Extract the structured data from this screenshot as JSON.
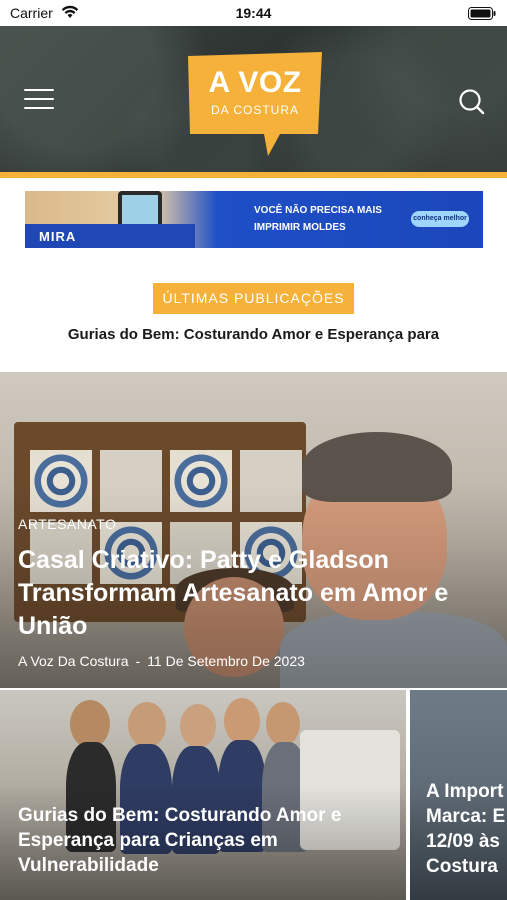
{
  "status_bar": {
    "carrier": "Carrier",
    "time": "19:44"
  },
  "header": {
    "logo_line1": "A VOZ",
    "logo_line2": "DA COSTURA",
    "menu_icon": "hamburger-menu-icon",
    "search_icon": "search-icon",
    "accent_color": "#f5b13a",
    "background_color": "#343b39"
  },
  "ad_banner": {
    "brand": "MIRA",
    "headline_line1": "VOCÊ NÃO PRECISA MAIS",
    "headline_line2": "IMPRIMIR MOLDES",
    "cta": "conheça melhor"
  },
  "latest": {
    "badge": "ÚLTIMAS PUBLICAÇÕES",
    "ticker": "Gurias do Bem: Costurando Amor e Esperança para"
  },
  "featured": {
    "category": "ARTESANATO",
    "title": "Casal Criativo: Patty e Gladson Transformam Artesanato em Amor e União",
    "author": "A Voz Da Costura",
    "separator": "-",
    "date": "11 De Setembro De 2023"
  },
  "cards": [
    {
      "title": "Gurias do Bem: Costurando Amor e Esperança para Crianças em Vulnerabilidade"
    },
    {
      "title": "A Import Marca: E 12/09 às Costura"
    }
  ]
}
